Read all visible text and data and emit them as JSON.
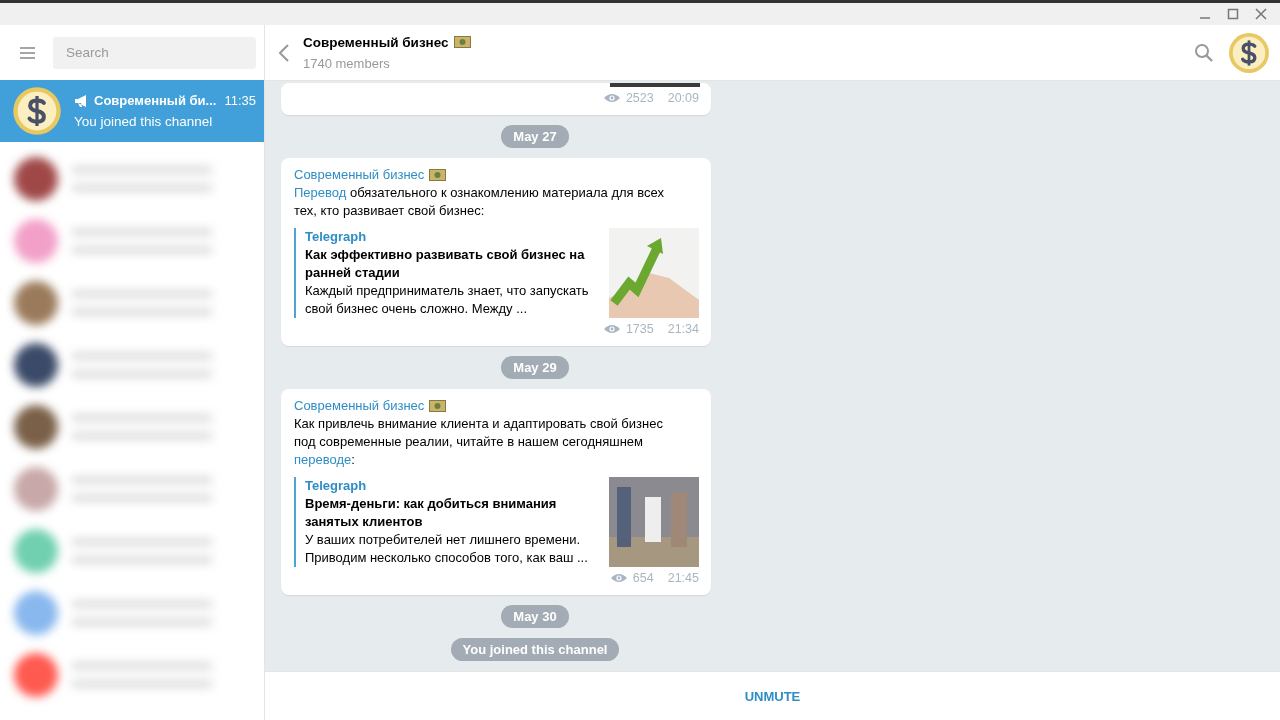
{
  "sidebar": {
    "search": {
      "placeholder": "Search"
    },
    "active_chat": {
      "name": "Современный би...",
      "time": "11:35",
      "preview": "You joined this channel",
      "selected": true
    },
    "blurred_chats": [
      {
        "color": "#a04848"
      },
      {
        "color": "#f2a0c8"
      },
      {
        "color": "#9a7a5a"
      },
      {
        "color": "#3a4a68"
      },
      {
        "color": "#7a6048"
      },
      {
        "color": "#c8a8a8"
      },
      {
        "color": "#70d0b0"
      },
      {
        "color": "#88b8ee"
      },
      {
        "color": "#ff5a50"
      }
    ]
  },
  "header": {
    "title": "Современный бизнес",
    "subtitle": "1740 members"
  },
  "messages": [
    {
      "kind": "partial",
      "views": "2523",
      "time": "20:09"
    },
    {
      "kind": "date",
      "text": "May 27"
    },
    {
      "kind": "post",
      "author": "Современный бизнес",
      "parts": [
        {
          "text": "Перевод",
          "link": true
        },
        {
          "text": " обязательного к ознакомлению материала для всех тех, кто развивает свой бизнес:",
          "link": false
        }
      ],
      "preview": {
        "site": "Telegraph",
        "title": "Как эффективно развивать свой бизнес на ранней стадии",
        "description": "Каждый предприниматель знает, что запускать свой бизнес очень сложно. Между ..."
      },
      "views": "1735",
      "time": "21:34"
    },
    {
      "kind": "date",
      "text": "May 29"
    },
    {
      "kind": "post",
      "author": "Современный бизнес",
      "parts": [
        {
          "text": "Как привлечь внимание клиента и адаптировать свой бизнес под современные реалии, читайте в нашем сегодняшнем ",
          "link": false
        },
        {
          "text": "переводе",
          "link": true
        },
        {
          "text": ":",
          "link": false
        }
      ],
      "preview": {
        "site": "Telegraph",
        "title": "Время-деньги: как добиться внимания занятых клиентов",
        "description": "У ваших потребителей нет лишнего времени. Приводим несколько способов того, как ваш ..."
      },
      "views": "654",
      "time": "21:45"
    },
    {
      "kind": "date",
      "text": "May 30"
    },
    {
      "kind": "service",
      "text": "You joined this channel"
    }
  ],
  "bottom_button": "UNMUTE"
}
